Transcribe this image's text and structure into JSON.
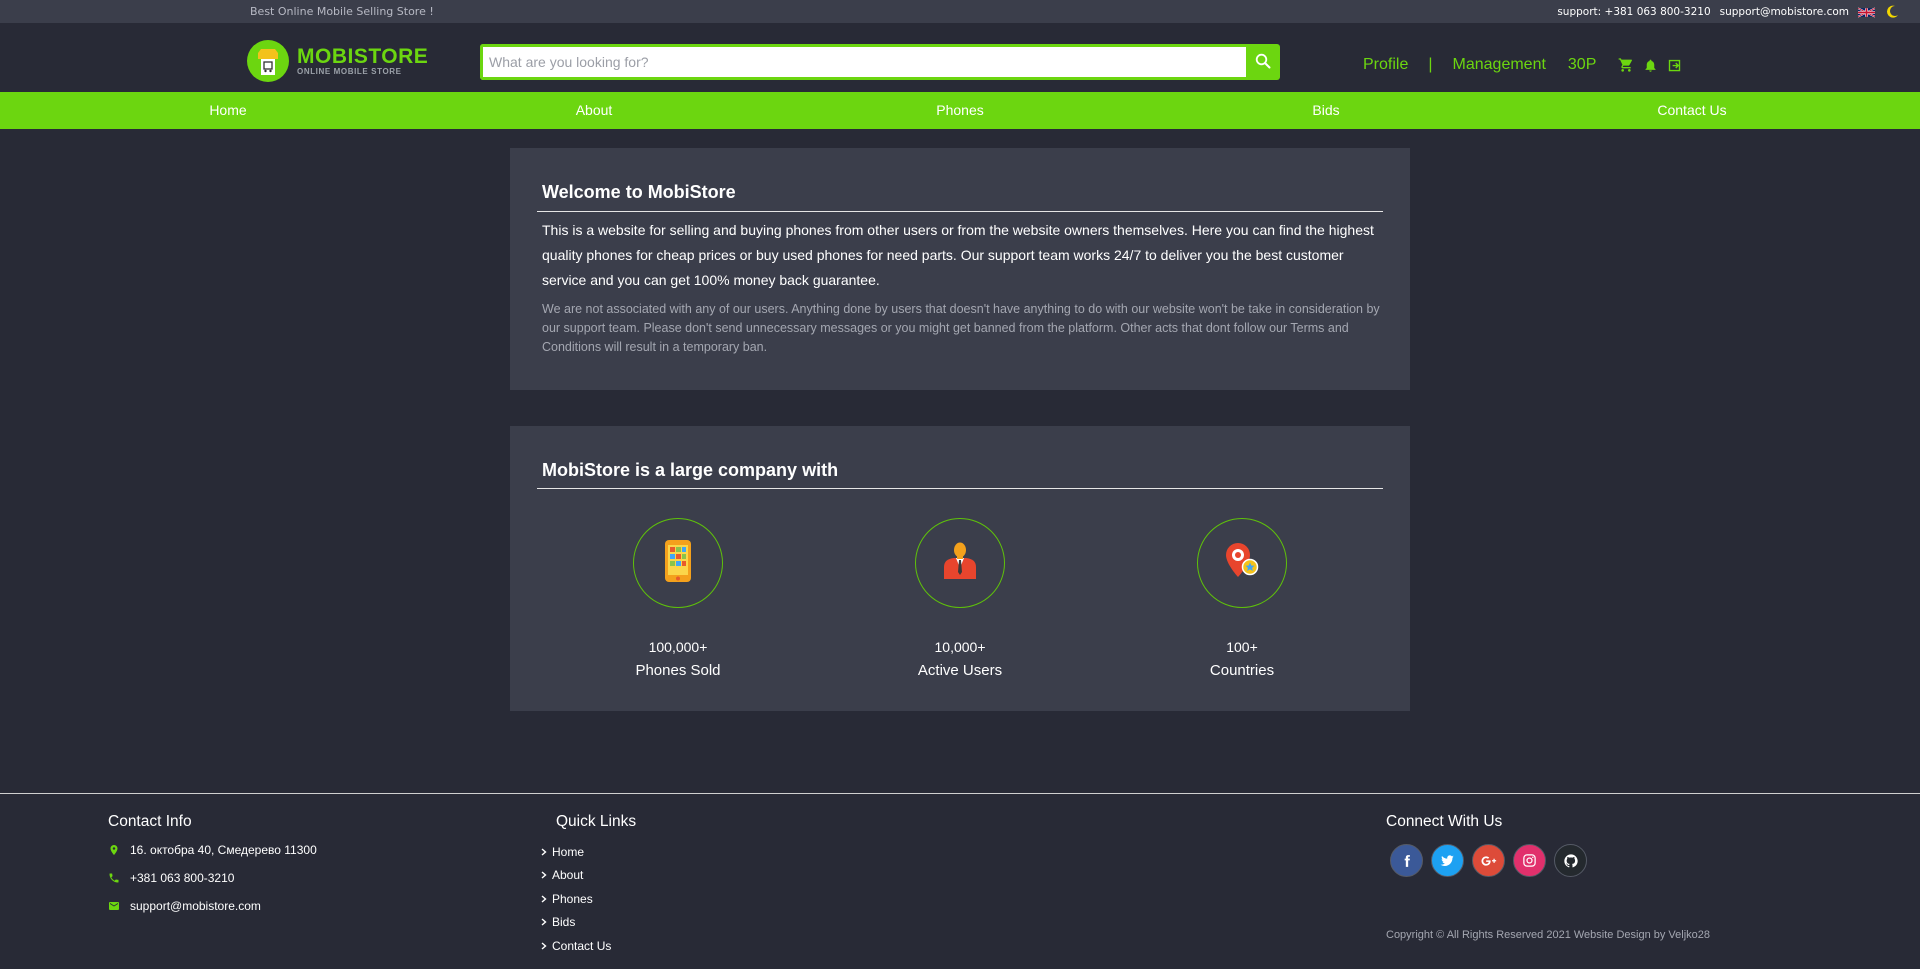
{
  "topbar": {
    "slogan": "Best Online Mobile Selling Store !",
    "support_phone": "support: +381 063 800-3210",
    "support_email": "support@mobistore.com",
    "language_icon": "uk-flag-icon",
    "theme_icon": "moon-icon"
  },
  "header": {
    "logo_title": "MOBISTORE",
    "logo_subtitle": "ONLINE MOBILE STORE",
    "search_placeholder": "What are you looking for?",
    "search_value": "",
    "profile_label": "Profile",
    "separator": "|",
    "management_label": "Management",
    "coins": "30P"
  },
  "nav": {
    "items": [
      "Home",
      "About",
      "Phones",
      "Bids",
      "Contact Us"
    ]
  },
  "welcome": {
    "title": "Welcome to MobiStore",
    "lead": "This is a website for selling and buying phones from other users or from the website owners themselves. Here you can find the highest quality phones for cheap prices or buy used phones for need parts. Our support team works 24/7 to deliver you the best customer service and you can get 100% money back guarantee.",
    "note": "We are not associated with any of our users. Anything done by users that doesn't have anything to do with our website won't be take in consideration by our support team. Please don't send unnecessary messages or you might get banned from the platform. Other acts that dont follow our Terms and Conditions will result in a temporary ban."
  },
  "company": {
    "title": "MobiStore is a large company with",
    "stats": [
      {
        "value": "100,000+",
        "label": "Phones Sold",
        "icon": "phone-icon"
      },
      {
        "value": "10,000+",
        "label": "Active Users",
        "icon": "user-icon"
      },
      {
        "value": "100+",
        "label": "Countries",
        "icon": "location-pin-icon"
      }
    ]
  },
  "footer": {
    "contact_title": "Contact Info",
    "address": "16. октобра 40, Смедерево 11300",
    "phone": "+381 063 800-3210",
    "email": "support@mobistore.com",
    "links_title": "Quick Links",
    "links": [
      "Home",
      "About",
      "Phones",
      "Bids",
      "Contact Us"
    ],
    "connect_title": "Connect With Us",
    "socials": [
      {
        "name": "facebook",
        "color": "#3b5998"
      },
      {
        "name": "twitter",
        "color": "#1da1f2"
      },
      {
        "name": "google-plus",
        "color": "#dd4b39"
      },
      {
        "name": "instagram",
        "color": "#e1306c"
      },
      {
        "name": "github",
        "color": "#24292e"
      }
    ],
    "copyright": "Copyright © All Rights Reserved 2021 Website Design by Veljko28"
  },
  "colors": {
    "accent": "#6cd610",
    "background": "#282a36",
    "card": "#3b3e4b"
  }
}
